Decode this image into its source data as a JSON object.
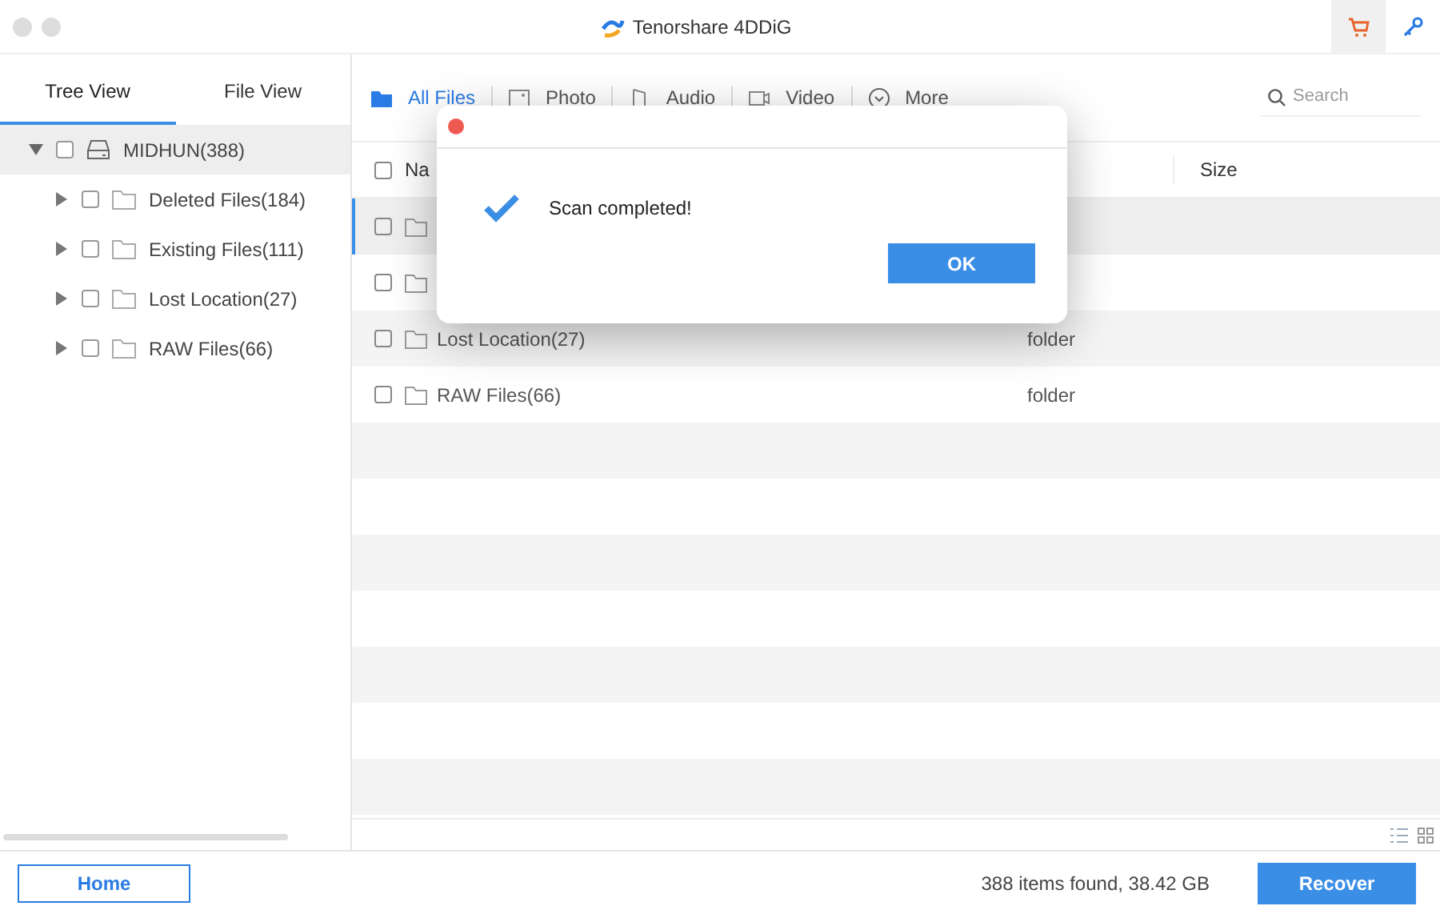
{
  "window": {
    "title": "Tenorshare 4DDiG"
  },
  "sidebar": {
    "tabs": [
      {
        "label": "Tree View",
        "selected": true
      },
      {
        "label": "File View",
        "selected": false
      }
    ],
    "tree": [
      {
        "label": "MIDHUN(388)",
        "kind": "drive",
        "expanded": true,
        "checked": false,
        "selected": true,
        "children": [
          {
            "label": "Deleted Files(184)",
            "kind": "folder",
            "expanded": false,
            "checked": false,
            "selected": false
          },
          {
            "label": "Existing Files(111)",
            "kind": "folder",
            "expanded": false,
            "checked": false,
            "selected": false
          },
          {
            "label": "Lost Location(27)",
            "kind": "folder",
            "expanded": false,
            "checked": false,
            "selected": false
          },
          {
            "label": "RAW Files(66)",
            "kind": "folder",
            "expanded": false,
            "checked": false,
            "selected": false
          }
        ]
      }
    ]
  },
  "filters": [
    {
      "label": "All Files",
      "kind": "folder",
      "selected": true
    },
    {
      "label": "Photo",
      "kind": "photo",
      "selected": false
    },
    {
      "label": "Audio",
      "kind": "audio",
      "selected": false
    },
    {
      "label": "Video",
      "kind": "video",
      "selected": false
    },
    {
      "label": "More",
      "kind": "more",
      "selected": false
    }
  ],
  "search": {
    "placeholder": "Search"
  },
  "table": {
    "columns": [
      "Na",
      "Size"
    ],
    "all_checked": false,
    "rows": [
      {
        "selected": true,
        "checked": false
      },
      {
        "selected": false,
        "checked": false
      },
      {
        "name": "Lost Location(27)",
        "type": "folder",
        "selected": false,
        "checked": false
      },
      {
        "name": "RAW Files(66)",
        "type": "folder",
        "selected": false,
        "checked": false
      }
    ]
  },
  "dialog": {
    "message": "Scan completed!",
    "button": "OK"
  },
  "footer": {
    "home": "Home",
    "status": "388 items found, 38.42 GB",
    "recover": "Recover"
  }
}
